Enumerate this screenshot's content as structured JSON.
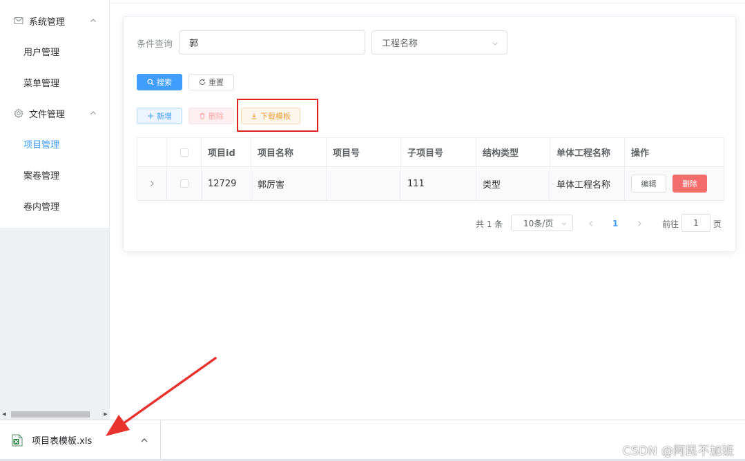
{
  "sidebar": {
    "groups": [
      {
        "label": "系统管理",
        "icon": "mail-icon",
        "items": [
          "用户管理",
          "菜单管理"
        ]
      },
      {
        "label": "文件管理",
        "icon": "gear-icon",
        "items": [
          "项目管理",
          "案卷管理",
          "卷内管理"
        ]
      }
    ],
    "active_item": "项目管理"
  },
  "search": {
    "label": "条件查询",
    "keyword_value": "郭",
    "field_select_value": "工程名称",
    "search_button": "搜索",
    "reset_button": "重置"
  },
  "toolbar": {
    "add_button": "新增",
    "delete_button": "删除",
    "download_template_button": "下载模板"
  },
  "table": {
    "columns": [
      "项目id",
      "项目名称",
      "项目号",
      "子项目号",
      "结构类型",
      "单体工程名称",
      "操作"
    ],
    "rows": [
      {
        "id": "12729",
        "name": "郭厉害",
        "project_no": "",
        "sub_project_no": "111",
        "structure_type": "类型",
        "unit_name": "单体工程名称",
        "edit": "编辑",
        "delete": "删除"
      }
    ]
  },
  "pagination": {
    "total_text": "共 1 条",
    "page_size": "10条/页",
    "current_page": "1",
    "goto_label": "前往",
    "goto_value": "1",
    "page_suffix": "页"
  },
  "download_bar": {
    "file_name": "项目表模板.xls",
    "file_icon": "excel-file-icon"
  },
  "watermark": "CSDN @阿民不加班",
  "colors": {
    "primary": "#409eff",
    "danger": "#f56c6c",
    "warning": "#e6a23c",
    "highlight_box": "#e02020"
  }
}
